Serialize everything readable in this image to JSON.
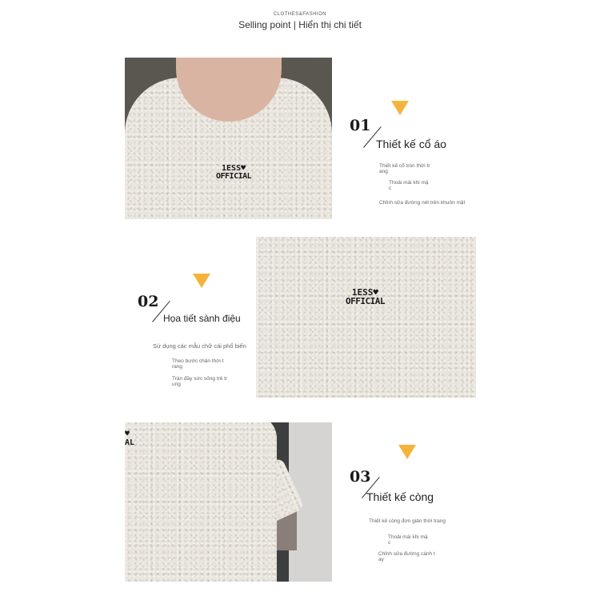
{
  "header": {
    "small": "CLOTHES&FASHION",
    "title": "Selling point | Hiển thị chi tiết"
  },
  "logo": {
    "line1": "1ESS",
    "heart": "♥",
    "line2": "OFFICIAL"
  },
  "partial_logo": {
    "line1": "♥",
    "line2": "AL"
  },
  "sections": [
    {
      "number": "01",
      "title": "Thiết kế cổ áo",
      "desc": [
        "Thiết kế cổ tròn thời tr\nang",
        "Thoải mái khi mặ\nc",
        "Chỉnh sửa đường nét trên khuôn mặt"
      ]
    },
    {
      "number": "02",
      "title": "Họa tiết sành điệu",
      "desc": [
        "Sử dụng các mẫu chữ cái phổ biến",
        "Theo bước chân thời t\nrang",
        "Tràn đầy sức sống trẻ tr\nung"
      ]
    },
    {
      "number": "03",
      "title": "Thiết kế còng",
      "desc": [
        "Thiết kế còng đơn giản thời trang",
        "Thoải mái khi mặ\nc",
        "Chỉnh sửa đường cánh t\nay"
      ]
    }
  ],
  "colors": {
    "accent": "#f4b43c",
    "fabric": "#e8e4dc"
  }
}
